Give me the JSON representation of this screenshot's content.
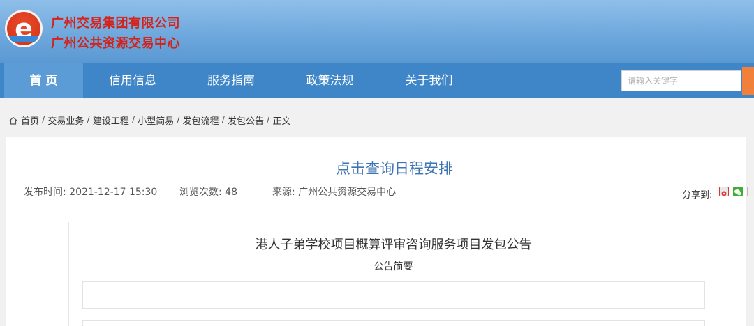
{
  "header": {
    "org_line1": "广州交易集团有限公司",
    "org_line2": "广州公共资源交易中心",
    "logo_letter": "e",
    "brand_color": "#d4221a"
  },
  "nav": {
    "items": [
      {
        "label": "首 页",
        "active": true
      },
      {
        "label": "信用信息"
      },
      {
        "label": "服务指南"
      },
      {
        "label": "政策法规"
      },
      {
        "label": "关于我们"
      }
    ],
    "search_placeholder": "请输入关键字",
    "bar_color": "#3e86c8"
  },
  "breadcrumb": {
    "items": [
      "首页",
      "交易业务",
      "建设工程",
      "小型简易",
      "发包流程",
      "发包公告",
      "正文"
    ],
    "separator": "/"
  },
  "article": {
    "title": "点击查询日程安排",
    "publish_label": "发布时间:",
    "publish_time": "2021-12-17 15:30",
    "views_label": "浏览次数:",
    "views": "48",
    "source_label": "来源:",
    "source": "广州公共资源交易中心",
    "share_label": "分享到:",
    "share_icons": [
      "weibo-icon",
      "wechat-icon",
      "more-share-icon"
    ]
  },
  "document": {
    "title": "港人子弟学校项目概算评审咨询服务项目发包公告",
    "subtitle": "公告简要"
  }
}
